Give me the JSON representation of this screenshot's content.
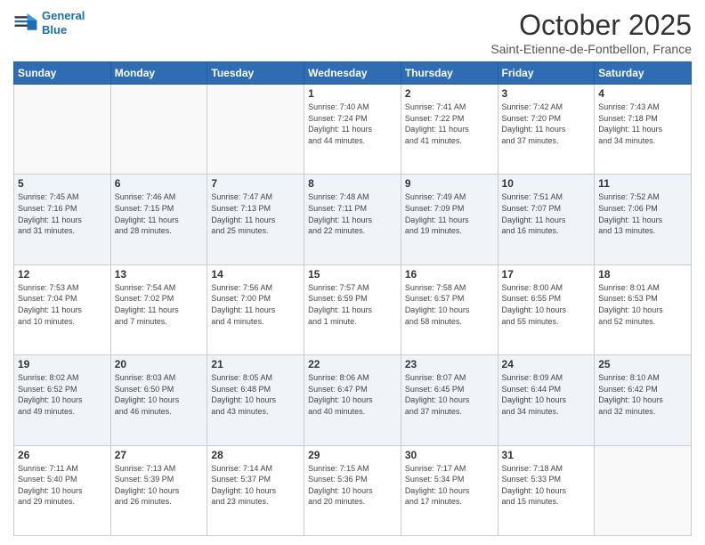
{
  "logo": {
    "line1": "General",
    "line2": "Blue"
  },
  "title": "October 2025",
  "location": "Saint-Etienne-de-Fontbellon, France",
  "headers": [
    "Sunday",
    "Monday",
    "Tuesday",
    "Wednesday",
    "Thursday",
    "Friday",
    "Saturday"
  ],
  "weeks": [
    [
      {
        "day": "",
        "info": ""
      },
      {
        "day": "",
        "info": ""
      },
      {
        "day": "",
        "info": ""
      },
      {
        "day": "1",
        "info": "Sunrise: 7:40 AM\nSunset: 7:24 PM\nDaylight: 11 hours\nand 44 minutes."
      },
      {
        "day": "2",
        "info": "Sunrise: 7:41 AM\nSunset: 7:22 PM\nDaylight: 11 hours\nand 41 minutes."
      },
      {
        "day": "3",
        "info": "Sunrise: 7:42 AM\nSunset: 7:20 PM\nDaylight: 11 hours\nand 37 minutes."
      },
      {
        "day": "4",
        "info": "Sunrise: 7:43 AM\nSunset: 7:18 PM\nDaylight: 11 hours\nand 34 minutes."
      }
    ],
    [
      {
        "day": "5",
        "info": "Sunrise: 7:45 AM\nSunset: 7:16 PM\nDaylight: 11 hours\nand 31 minutes."
      },
      {
        "day": "6",
        "info": "Sunrise: 7:46 AM\nSunset: 7:15 PM\nDaylight: 11 hours\nand 28 minutes."
      },
      {
        "day": "7",
        "info": "Sunrise: 7:47 AM\nSunset: 7:13 PM\nDaylight: 11 hours\nand 25 minutes."
      },
      {
        "day": "8",
        "info": "Sunrise: 7:48 AM\nSunset: 7:11 PM\nDaylight: 11 hours\nand 22 minutes."
      },
      {
        "day": "9",
        "info": "Sunrise: 7:49 AM\nSunset: 7:09 PM\nDaylight: 11 hours\nand 19 minutes."
      },
      {
        "day": "10",
        "info": "Sunrise: 7:51 AM\nSunset: 7:07 PM\nDaylight: 11 hours\nand 16 minutes."
      },
      {
        "day": "11",
        "info": "Sunrise: 7:52 AM\nSunset: 7:06 PM\nDaylight: 11 hours\nand 13 minutes."
      }
    ],
    [
      {
        "day": "12",
        "info": "Sunrise: 7:53 AM\nSunset: 7:04 PM\nDaylight: 11 hours\nand 10 minutes."
      },
      {
        "day": "13",
        "info": "Sunrise: 7:54 AM\nSunset: 7:02 PM\nDaylight: 11 hours\nand 7 minutes."
      },
      {
        "day": "14",
        "info": "Sunrise: 7:56 AM\nSunset: 7:00 PM\nDaylight: 11 hours\nand 4 minutes."
      },
      {
        "day": "15",
        "info": "Sunrise: 7:57 AM\nSunset: 6:59 PM\nDaylight: 11 hours\nand 1 minute."
      },
      {
        "day": "16",
        "info": "Sunrise: 7:58 AM\nSunset: 6:57 PM\nDaylight: 10 hours\nand 58 minutes."
      },
      {
        "day": "17",
        "info": "Sunrise: 8:00 AM\nSunset: 6:55 PM\nDaylight: 10 hours\nand 55 minutes."
      },
      {
        "day": "18",
        "info": "Sunrise: 8:01 AM\nSunset: 6:53 PM\nDaylight: 10 hours\nand 52 minutes."
      }
    ],
    [
      {
        "day": "19",
        "info": "Sunrise: 8:02 AM\nSunset: 6:52 PM\nDaylight: 10 hours\nand 49 minutes."
      },
      {
        "day": "20",
        "info": "Sunrise: 8:03 AM\nSunset: 6:50 PM\nDaylight: 10 hours\nand 46 minutes."
      },
      {
        "day": "21",
        "info": "Sunrise: 8:05 AM\nSunset: 6:48 PM\nDaylight: 10 hours\nand 43 minutes."
      },
      {
        "day": "22",
        "info": "Sunrise: 8:06 AM\nSunset: 6:47 PM\nDaylight: 10 hours\nand 40 minutes."
      },
      {
        "day": "23",
        "info": "Sunrise: 8:07 AM\nSunset: 6:45 PM\nDaylight: 10 hours\nand 37 minutes."
      },
      {
        "day": "24",
        "info": "Sunrise: 8:09 AM\nSunset: 6:44 PM\nDaylight: 10 hours\nand 34 minutes."
      },
      {
        "day": "25",
        "info": "Sunrise: 8:10 AM\nSunset: 6:42 PM\nDaylight: 10 hours\nand 32 minutes."
      }
    ],
    [
      {
        "day": "26",
        "info": "Sunrise: 7:11 AM\nSunset: 5:40 PM\nDaylight: 10 hours\nand 29 minutes."
      },
      {
        "day": "27",
        "info": "Sunrise: 7:13 AM\nSunset: 5:39 PM\nDaylight: 10 hours\nand 26 minutes."
      },
      {
        "day": "28",
        "info": "Sunrise: 7:14 AM\nSunset: 5:37 PM\nDaylight: 10 hours\nand 23 minutes."
      },
      {
        "day": "29",
        "info": "Sunrise: 7:15 AM\nSunset: 5:36 PM\nDaylight: 10 hours\nand 20 minutes."
      },
      {
        "day": "30",
        "info": "Sunrise: 7:17 AM\nSunset: 5:34 PM\nDaylight: 10 hours\nand 17 minutes."
      },
      {
        "day": "31",
        "info": "Sunrise: 7:18 AM\nSunset: 5:33 PM\nDaylight: 10 hours\nand 15 minutes."
      },
      {
        "day": "",
        "info": ""
      }
    ]
  ]
}
